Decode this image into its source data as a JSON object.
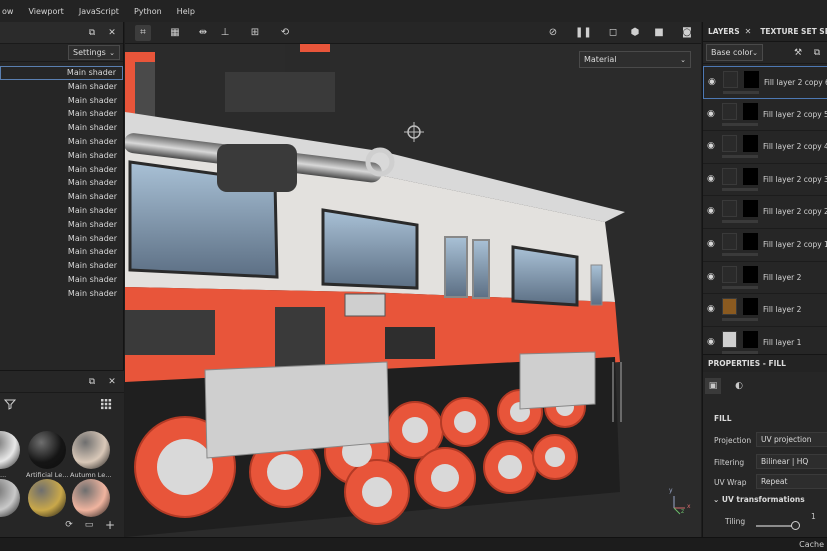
{
  "menu": [
    "ow",
    "Viewport",
    "JavaScript",
    "Python",
    "Help"
  ],
  "left_panel": {
    "settings_label": "Settings",
    "shaders": [
      "Main shader",
      "Main shader",
      "Main shader",
      "Main shader",
      "Main shader",
      "Main shader",
      "Main shader",
      "Main shader",
      "Main shader",
      "Main shader",
      "Main shader",
      "Main shader",
      "Main shader",
      "Main shader",
      "Main shader",
      "Main shader",
      "Main shader"
    ]
  },
  "shelf": {
    "materials": [
      {
        "label": "...",
        "color": "#e8e8e8"
      },
      {
        "label": "Artificial Le...",
        "color": "#151515"
      },
      {
        "label": "Autumn Le...",
        "color": "#d9c8b8"
      },
      {
        "label": "",
        "color": "#c9c9c9"
      },
      {
        "label": "",
        "color": "#c9a84a"
      },
      {
        "label": "",
        "color": "#f0b49f"
      }
    ]
  },
  "viewport": {
    "channel_select": "Material",
    "axis_labels": {
      "y": "y",
      "x": "x",
      "z": "z"
    }
  },
  "right_panel": {
    "tabs": [
      "LAYERS",
      "TEXTURE SET SE"
    ],
    "channel": "Base color",
    "layers": [
      {
        "name": "Fill layer 2 copy 6",
        "selected": true,
        "thumb": "#2a2a2a"
      },
      {
        "name": "Fill layer 2 copy 5",
        "selected": false,
        "thumb": "#2a2a2a"
      },
      {
        "name": "Fill layer 2 copy 4",
        "selected": false,
        "thumb": "#2a2a2a"
      },
      {
        "name": "Fill layer 2 copy 3",
        "selected": false,
        "thumb": "#2a2a2a"
      },
      {
        "name": "Fill layer 2 copy 2",
        "selected": false,
        "thumb": "#2a2a2a"
      },
      {
        "name": "Fill layer 2 copy 1",
        "selected": false,
        "thumb": "#2a2a2a"
      },
      {
        "name": "Fill layer 2",
        "selected": false,
        "thumb": "#2a2a2a"
      },
      {
        "name": "Fill layer 2",
        "selected": false,
        "thumb": "#8a5a20"
      },
      {
        "name": "Fill layer 1",
        "selected": false,
        "thumb": "#cfcfcf"
      }
    ],
    "properties_title": "PROPERTIES - FILL",
    "fill_title": "FILL",
    "projection_label": "Projection",
    "projection_value": "UV projection",
    "filtering_label": "Filtering",
    "filtering_value": "Bilinear | HQ",
    "uvwrap_label": "UV Wrap",
    "uvwrap_value": "Repeat",
    "uv_transformations": "UV transformations",
    "tiling_label": "Tiling",
    "tiling_value": "1"
  },
  "status": {
    "text": "Cache"
  },
  "colors": {
    "accent": "#4d78b3",
    "tank_orange": "#e8553a"
  }
}
